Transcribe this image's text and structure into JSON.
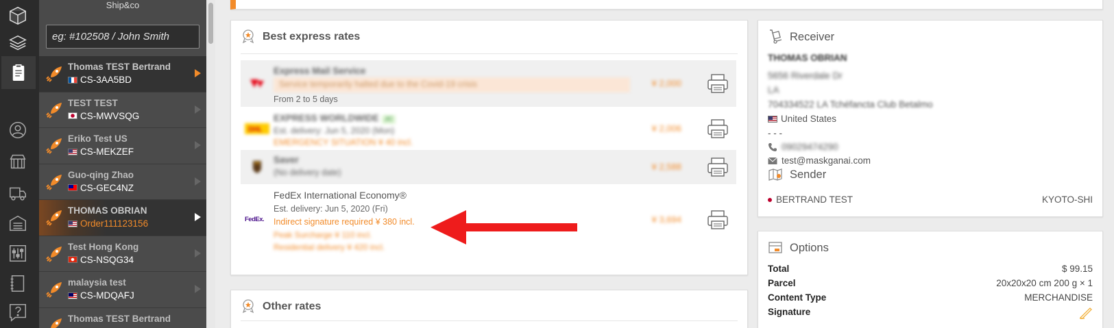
{
  "sidebar": {
    "brand": "Ship&co",
    "search_placeholder": "eg: #102508 / John Smith",
    "orders": [
      {
        "name": "Thomas TEST Bertrand",
        "ref": "CS-3AA5BD",
        "flag": "FR"
      },
      {
        "name": "TEST TEST",
        "ref": "CS-MWVSQG",
        "flag": "JP"
      },
      {
        "name": "Eriko Test US",
        "ref": "CS-MEKZEF",
        "flag": "US"
      },
      {
        "name": "Guo-qing Zhao",
        "ref": "CS-GEC4NZ",
        "flag": "TW"
      },
      {
        "name": "THOMAS OBRIAN",
        "ref": "Order111123156",
        "flag": "US"
      },
      {
        "name": "Test Hong Kong",
        "ref": "CS-NSQG34",
        "flag": "HK"
      },
      {
        "name": "malaysia test",
        "ref": "CS-MDQAFJ",
        "flag": "MY"
      },
      {
        "name": "Thomas TEST Bertrand",
        "ref": "",
        "flag": ""
      }
    ]
  },
  "best_rates": {
    "title": "Best express rates",
    "rates": [
      {
        "service": "Express Mail Service",
        "note": "Service temporarily halted due to the Covid-19 crisis",
        "delivery": "From 2 to 5 days",
        "price": "¥ 2,000"
      },
      {
        "service": "EXPRESS WORLDWIDE",
        "badge": "JC",
        "delivery": "Est. delivery: Jun 5, 2020 (Mon)",
        "surcharge": "EMERGENCY SITUATION ¥ 40 incl.",
        "price": "¥ 2,006"
      },
      {
        "service": "Saver",
        "delivery": "(No delivery date)",
        "price": "¥ 2,588"
      },
      {
        "service": "FedEx International Economy®",
        "delivery": "Est. delivery: Jun 5, 2020 (Fri)",
        "surcharge1": "Indirect signature required ¥ 380 incl.",
        "surcharge2": "Peak Surcharge ¥ 110 incl.",
        "surcharge3": "Residential delivery ¥ 420 incl.",
        "price": "¥ 3,694",
        "logo": "FedEx."
      }
    ]
  },
  "other_rates": {
    "title": "Other rates"
  },
  "receiver": {
    "title": "Receiver",
    "name": "THOMAS OBRIAN",
    "address1": "5656 Riverdale Dr",
    "city": "LA",
    "zip": "704334522 LA Tchéfancta Club Betalmo",
    "country": "United States",
    "dashes": "- - -",
    "phone": "09029474290",
    "email": "test@maskganai.com"
  },
  "sender": {
    "title": "Sender",
    "name": "BERTRAND TEST",
    "city": "KYOTO-SHI"
  },
  "options": {
    "title": "Options",
    "rows": [
      {
        "label": "Total",
        "value": "$ 99.15"
      },
      {
        "label": "Parcel",
        "value": "20x20x20 cm 200 g × 1"
      },
      {
        "label": "Content Type",
        "value": "MERCHANDISE"
      },
      {
        "label": "Signature",
        "value": ""
      }
    ]
  },
  "colors": {
    "accent": "#f28b2a",
    "annotation_arrow": "#ee1c1c"
  }
}
